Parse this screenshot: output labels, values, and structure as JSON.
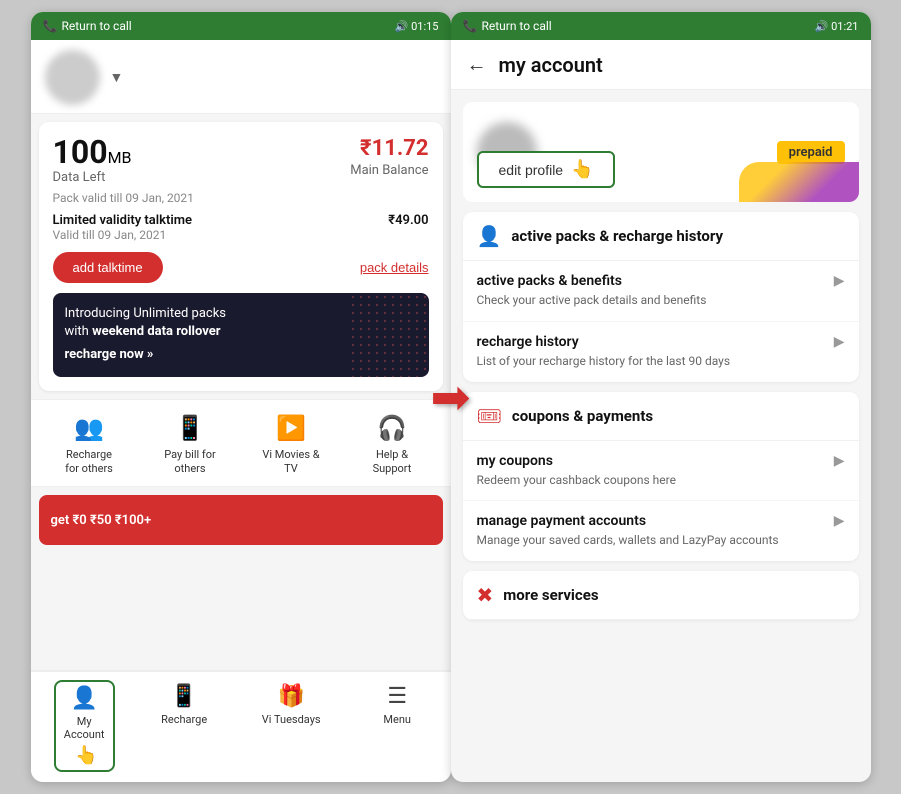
{
  "phone1": {
    "statusBar": {
      "callText": "Return to call",
      "time": "01:15"
    },
    "balance": {
      "dataAmount": "100",
      "dataUnit": "MB",
      "dataLabel": "Data Left",
      "mainBalance": "₹11.72",
      "mainBalanceLabel": "Main Balance",
      "validity": "Pack valid till 09 Jan, 2021",
      "talktimeTitle": "Limited validity talktime",
      "talktimeValidity": "Valid till 09 Jan, 2021",
      "talktimePrice": "₹49.00",
      "addTalktime": "add talktime",
      "packDetails": "pack details"
    },
    "promo": {
      "text": "Introducing Unlimited packs\nwith weekend data rollover",
      "cta": "recharge now »"
    },
    "quickActions": [
      {
        "icon": "👥",
        "label": "Recharge\nfor others"
      },
      {
        "icon": "📱",
        "label": "Pay bill for\nothers"
      },
      {
        "icon": "▶",
        "label": "Vi Movies &\nTV"
      },
      {
        "icon": "🎧",
        "label": "Help &\nSupport"
      }
    ],
    "bottomNav": [
      {
        "icon": "👤",
        "label": "My\nAccount",
        "active": true
      },
      {
        "icon": "📱",
        "label": "Recharge",
        "active": false
      },
      {
        "icon": "🎁",
        "label": "Vi Tuesdays",
        "active": false
      },
      {
        "icon": "☰",
        "label": "Menu",
        "active": false
      }
    ]
  },
  "phone2": {
    "statusBar": {
      "callText": "Return to call",
      "time": "01:21"
    },
    "header": {
      "backLabel": "←",
      "title": "my account"
    },
    "profile": {
      "badge": "prepaid",
      "editBtn": "edit profile"
    },
    "sections": [
      {
        "id": "active-packs",
        "icon": "👤",
        "title": "active packs & recharge history",
        "items": [
          {
            "title": "active packs & benefits",
            "desc": "Check your active pack details and benefits"
          },
          {
            "title": "recharge history",
            "desc": "List of your recharge history for the last 90 days"
          }
        ]
      },
      {
        "id": "coupons",
        "icon": "🎟",
        "title": "coupons & payments",
        "items": [
          {
            "title": "my coupons",
            "desc": "Redeem your cashback coupons here"
          },
          {
            "title": "manage payment accounts",
            "desc": "Manage your saved cards, wallets and LazyPay accounts"
          }
        ]
      },
      {
        "id": "more-services",
        "icon": "⊗",
        "title": "more services",
        "items": []
      }
    ]
  }
}
